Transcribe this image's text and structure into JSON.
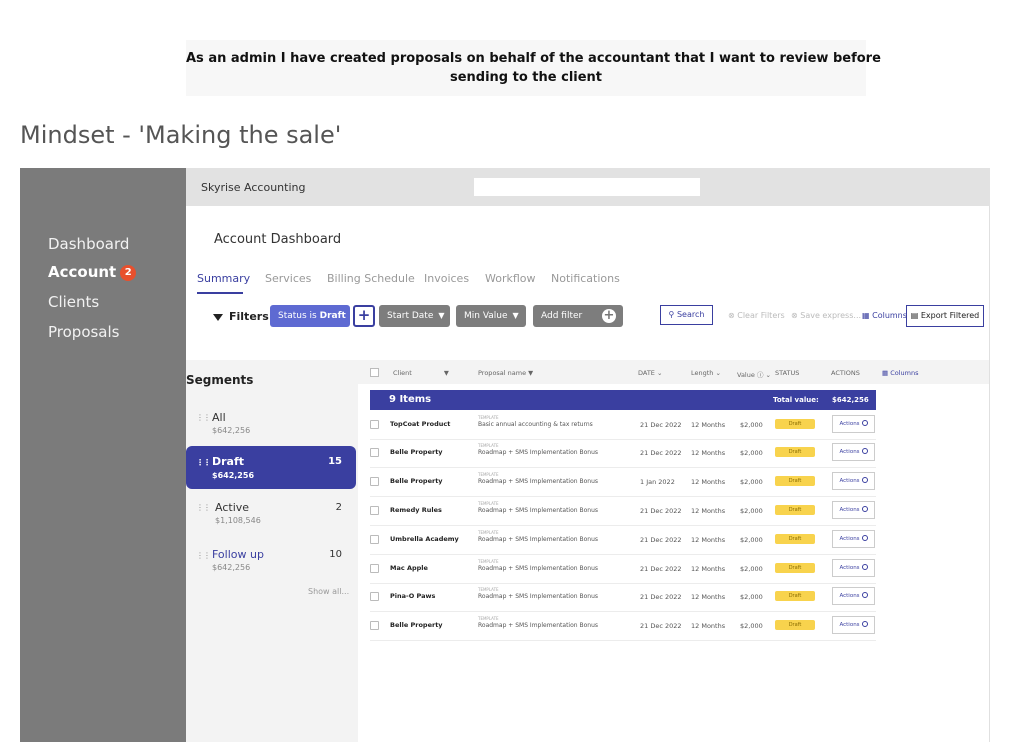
{
  "banner": {
    "line1": "As an admin I have created proposals on behalf of the accountant that I want to review before",
    "line2": "sending to the client"
  },
  "heading": "Mindset - 'Making the sale'",
  "sidebar": {
    "items": [
      {
        "label": "Dashboard"
      },
      {
        "label": "Account",
        "badge": "2"
      },
      {
        "label": "Clients"
      },
      {
        "label": "Proposals"
      }
    ]
  },
  "topbar": {
    "company": "Skyrise Accounting"
  },
  "page": {
    "title": "Account Dashboard"
  },
  "tabs": [
    {
      "label": "Summary"
    },
    {
      "label": "Services"
    },
    {
      "label": "Billing Schedule"
    },
    {
      "label": "Invoices"
    },
    {
      "label": "Workflow"
    },
    {
      "label": "Notifications"
    }
  ],
  "filters": {
    "label": "Filters",
    "status_prefix": "Status is",
    "status_value": "Draft",
    "add_label": "+",
    "start_date": "Start Date",
    "min_value": "Min Value",
    "add_filter": "Add filter",
    "search": "Search",
    "clear": "Clear Filters",
    "save": "Save express...",
    "columns": "Columns",
    "export": "Export Filtered"
  },
  "segments": {
    "title": "Segments",
    "items": [
      {
        "name": "All",
        "amount": "$642,256",
        "count": ""
      },
      {
        "name": "Draft",
        "amount": "$642,256",
        "count": "15"
      },
      {
        "name": "Active",
        "amount": "$1,108,546",
        "count": "2"
      },
      {
        "name": "Follow up",
        "amount": "$642,256",
        "count": "10"
      }
    ],
    "show_all": "Show all..."
  },
  "table": {
    "headers": {
      "client": "Client",
      "proposal": "Proposal name",
      "date": "DATE",
      "length": "Length",
      "value": "Value",
      "status": "STATUS",
      "actions": "ACTIONS",
      "columns": "Columns"
    },
    "group": {
      "label": "9 Items",
      "total_label": "Total value:",
      "total_value": "$642,256"
    },
    "rows": [
      {
        "client": "TopCoat Product",
        "template": "TEMPLATE",
        "title": "Basic annual accounting & tax returns",
        "date": "21 Dec 2022",
        "length": "12 Months",
        "value": "$2,000",
        "status": "Draft",
        "action": "Actions"
      },
      {
        "client": "Belle Property",
        "template": "TEMPLATE",
        "title": "Roadmap + SMS Implementation Bonus",
        "date": "21 Dec 2022",
        "length": "12 Months",
        "value": "$2,000",
        "status": "Draft",
        "action": "Actions"
      },
      {
        "client": "Belle Property",
        "template": "TEMPLATE",
        "title": "Roadmap + SMS Implementation Bonus",
        "date": "1 Jan 2022",
        "length": "12 Months",
        "value": "$2,000",
        "status": "Draft",
        "action": "Actions"
      },
      {
        "client": "Remedy Rules",
        "template": "TEMPLATE",
        "title": "Roadmap + SMS Implementation Bonus",
        "date": "21 Dec 2022",
        "length": "12 Months",
        "value": "$2,000",
        "status": "Draft",
        "action": "Actions"
      },
      {
        "client": "Umbrella Academy",
        "template": "TEMPLATE",
        "title": "Roadmap + SMS Implementation Bonus",
        "date": "21 Dec 2022",
        "length": "12 Months",
        "value": "$2,000",
        "status": "Draft",
        "action": "Actions"
      },
      {
        "client": "Mac Apple",
        "template": "TEMPLATE",
        "title": "Roadmap + SMS Implementation Bonus",
        "date": "21 Dec 2022",
        "length": "12 Months",
        "value": "$2,000",
        "status": "Draft",
        "action": "Actions"
      },
      {
        "client": "Pina-O Paws",
        "template": "TEMPLATE",
        "title": "Roadmap + SMS Implementation Bonus",
        "date": "21 Dec 2022",
        "length": "12 Months",
        "value": "$2,000",
        "status": "Draft",
        "action": "Actions"
      },
      {
        "client": "Belle Property",
        "template": "TEMPLATE",
        "title": "Roadmap + SMS Implementation Bonus",
        "date": "21 Dec 2022",
        "length": "12 Months",
        "value": "$2,000",
        "status": "Draft",
        "action": "Actions"
      }
    ]
  },
  "colors": {
    "accent": "#3a3fa0",
    "sidebar": "#7b7b7b",
    "status_draft": "#f8d34d",
    "badge": "#e8502d"
  }
}
